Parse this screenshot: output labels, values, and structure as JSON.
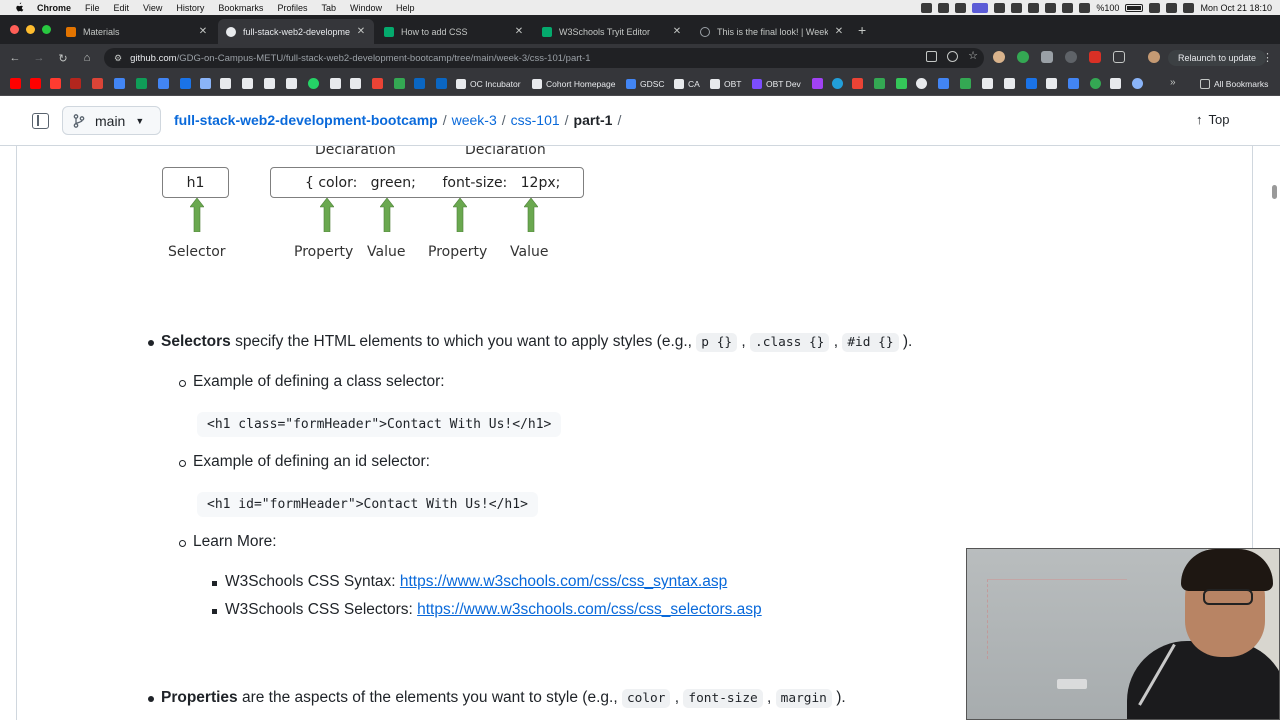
{
  "menubar": {
    "app": "Chrome",
    "items": [
      "File",
      "Edit",
      "View",
      "History",
      "Bookmarks",
      "Profiles",
      "Tab",
      "Window",
      "Help"
    ],
    "battery": "%100",
    "datetime": "Mon Oct 21  18:10"
  },
  "tabs": [
    {
      "title": "Materials",
      "color": "#e37400",
      "active": false
    },
    {
      "title": "full-stack-web2-developmen",
      "color": "#ffffff",
      "active": true
    },
    {
      "title": "How to add CSS",
      "color": "#04aa6d",
      "active": false
    },
    {
      "title": "W3Schools Tryit Editor",
      "color": "#04aa6d",
      "active": false
    },
    {
      "title": "This is the final look! | Week 3",
      "color": "#9aa0a6",
      "active": false
    }
  ],
  "address": {
    "host": "github.com",
    "path": "/GDG-on-Campus-METU/full-stack-web2-development-bootcamp/tree/main/week-3/css-101/part-1",
    "relaunch": "Relaunch to update"
  },
  "bookmarks": {
    "labeled": [
      "OC Incubator",
      "Cohort Homepage",
      "GDSC",
      "CA",
      "OBT",
      "OBT Dev"
    ],
    "all": "All Bookmarks"
  },
  "github": {
    "branch": "main",
    "crumbs": [
      "full-stack-web2-development-bootcamp",
      "week-3",
      "css-101"
    ],
    "current": "part-1",
    "top": "Top"
  },
  "diagram": {
    "decl1": "Declaration",
    "decl2": "Declaration",
    "selector_box": "h1",
    "rule_box": "{ color:   green;      font-size:   12px;",
    "selector": "Selector",
    "prop1": "Property",
    "val1": "Value",
    "prop2": "Property",
    "val2": "Value"
  },
  "doc": {
    "selectors_term": "Selectors",
    "selectors_text": " specify the HTML elements to which you want to apply styles (e.g., ",
    "sel_code1": "p {}",
    "sel_code2": ".class {}",
    "sel_code3": "#id {}",
    "sel_end": ").",
    "class_ex_label": "Example of defining a class selector:",
    "class_ex_code": "<h1 class=\"formHeader\">Contact With Us!</h1>",
    "id_ex_label": "Example of defining an id selector:",
    "id_ex_code": "<h1 id=\"formHeader\">Contact With Us!</h1>",
    "learn_more": "Learn More:",
    "link1_label": "W3Schools CSS Syntax: ",
    "link1_url": "https://www.w3schools.com/css/css_syntax.asp",
    "link2_label": "W3Schools CSS Selectors: ",
    "link2_url": "https://www.w3schools.com/css/css_selectors.asp",
    "properties_term": "Properties",
    "properties_text": " are the aspects of the elements you want to style (e.g., ",
    "prop_code1": "color",
    "prop_code2": "font-size",
    "prop_code3": "margin",
    "prop_end": ")."
  }
}
